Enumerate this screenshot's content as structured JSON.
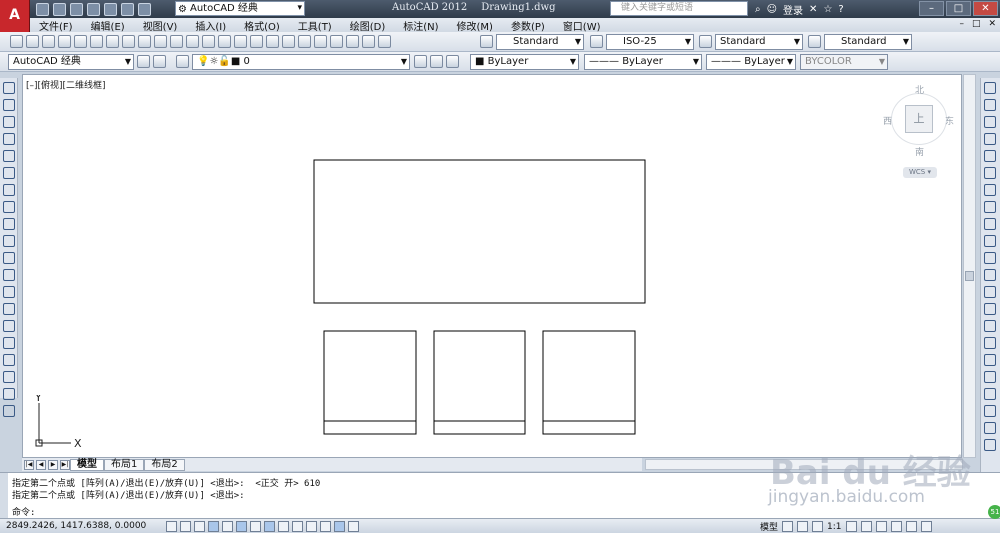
{
  "titlebar": {
    "logo": "A",
    "workspace": "AutoCAD 经典",
    "app_title": "AutoCAD 2012",
    "document_title": "Drawing1.dwg",
    "search_placeholder": "键入关键字或短语",
    "login": "登录",
    "help": "?"
  },
  "menu": {
    "items": [
      "文件(F)",
      "编辑(E)",
      "视图(V)",
      "插入(I)",
      "格式(O)",
      "工具(T)",
      "绘图(D)",
      "标注(N)",
      "修改(M)",
      "参数(P)",
      "窗口(W)"
    ],
    "window_controls": [
      "–",
      "□",
      "✕"
    ]
  },
  "toolbar1": {
    "text_style": "Standard",
    "dim_style": "ISO-25",
    "table_style": "Standard",
    "multileader_style": "Standard"
  },
  "toolbar2": {
    "workspace": "AutoCAD 经典",
    "layer": "0",
    "color": "ByLayer",
    "linetype": "ByLayer",
    "lineweight": "ByLayer",
    "plotstyle": "BYCOLOR"
  },
  "viewport": {
    "label": "[–][俯视][二维线框]"
  },
  "viewcube": {
    "north": "北",
    "south": "南",
    "west": "西",
    "east": "东",
    "face": "上",
    "wcs": "WCS"
  },
  "ucs": {
    "x": "X",
    "y": "Y"
  },
  "layout_tabs": [
    "模型",
    "布局1",
    "布局2"
  ],
  "command": {
    "history": [
      "指定第二个点或 [阵列(A)/退出(E)/放弃(U)] <退出>:  <正交 开> 610",
      "指定第二个点或 [阵列(A)/退出(E)/放弃(U)] <退出>:"
    ],
    "prompt": "命令:"
  },
  "status": {
    "coords": "2849.2426, 1417.6388, 0.0000",
    "model": "模型",
    "scale": "1:1"
  },
  "watermark": {
    "brand": "Bai du 经验",
    "url": "jingyan.baidu.com"
  },
  "badge": "51"
}
